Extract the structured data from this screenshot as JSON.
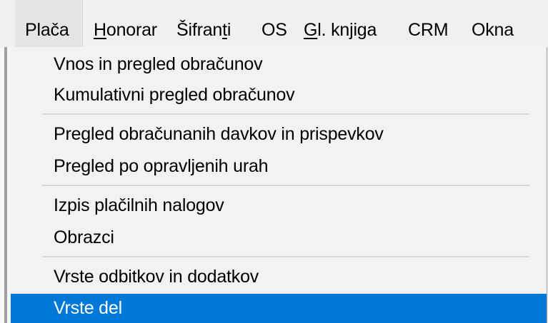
{
  "menubar": {
    "items": [
      {
        "label": "Plača",
        "pre": "",
        "mnemonic": "",
        "post": "Plača"
      },
      {
        "label": "Honorar",
        "pre": "",
        "mnemonic": "H",
        "post": "onorar"
      },
      {
        "label": "Šifranti",
        "pre": "Šifran",
        "mnemonic": "t",
        "post": "i"
      },
      {
        "label": "OS",
        "pre": "",
        "mnemonic": "",
        "post": "OS"
      },
      {
        "label": "Gl. knjiga",
        "pre": "",
        "mnemonic": "G",
        "post": "l. knjiga"
      },
      {
        "label": "CRM",
        "pre": "",
        "mnemonic": "",
        "post": "CRM"
      },
      {
        "label": "Okna",
        "pre": "",
        "mnemonic": "",
        "post": "Okna"
      }
    ],
    "active_index": 0
  },
  "dropdown": {
    "items": [
      {
        "label": "Vnos in pregled obračunov"
      },
      {
        "label": "Kumulativni pregled obračunov"
      },
      {
        "label": "Pregled obračunanih davkov in prispevkov"
      },
      {
        "label": "Pregled po opravljenih urah"
      },
      {
        "label": "Izpis plačilnih nalogov"
      },
      {
        "label": "Obrazci"
      },
      {
        "label": "Vrste odbitkov in dodatkov"
      },
      {
        "label": "Vrste del"
      }
    ],
    "selected_index": 7
  },
  "colors": {
    "selection": "#0078d7",
    "selection_text": "#ffffff",
    "menu_background": "#f2f2f2",
    "separator": "#d9d9d9"
  }
}
